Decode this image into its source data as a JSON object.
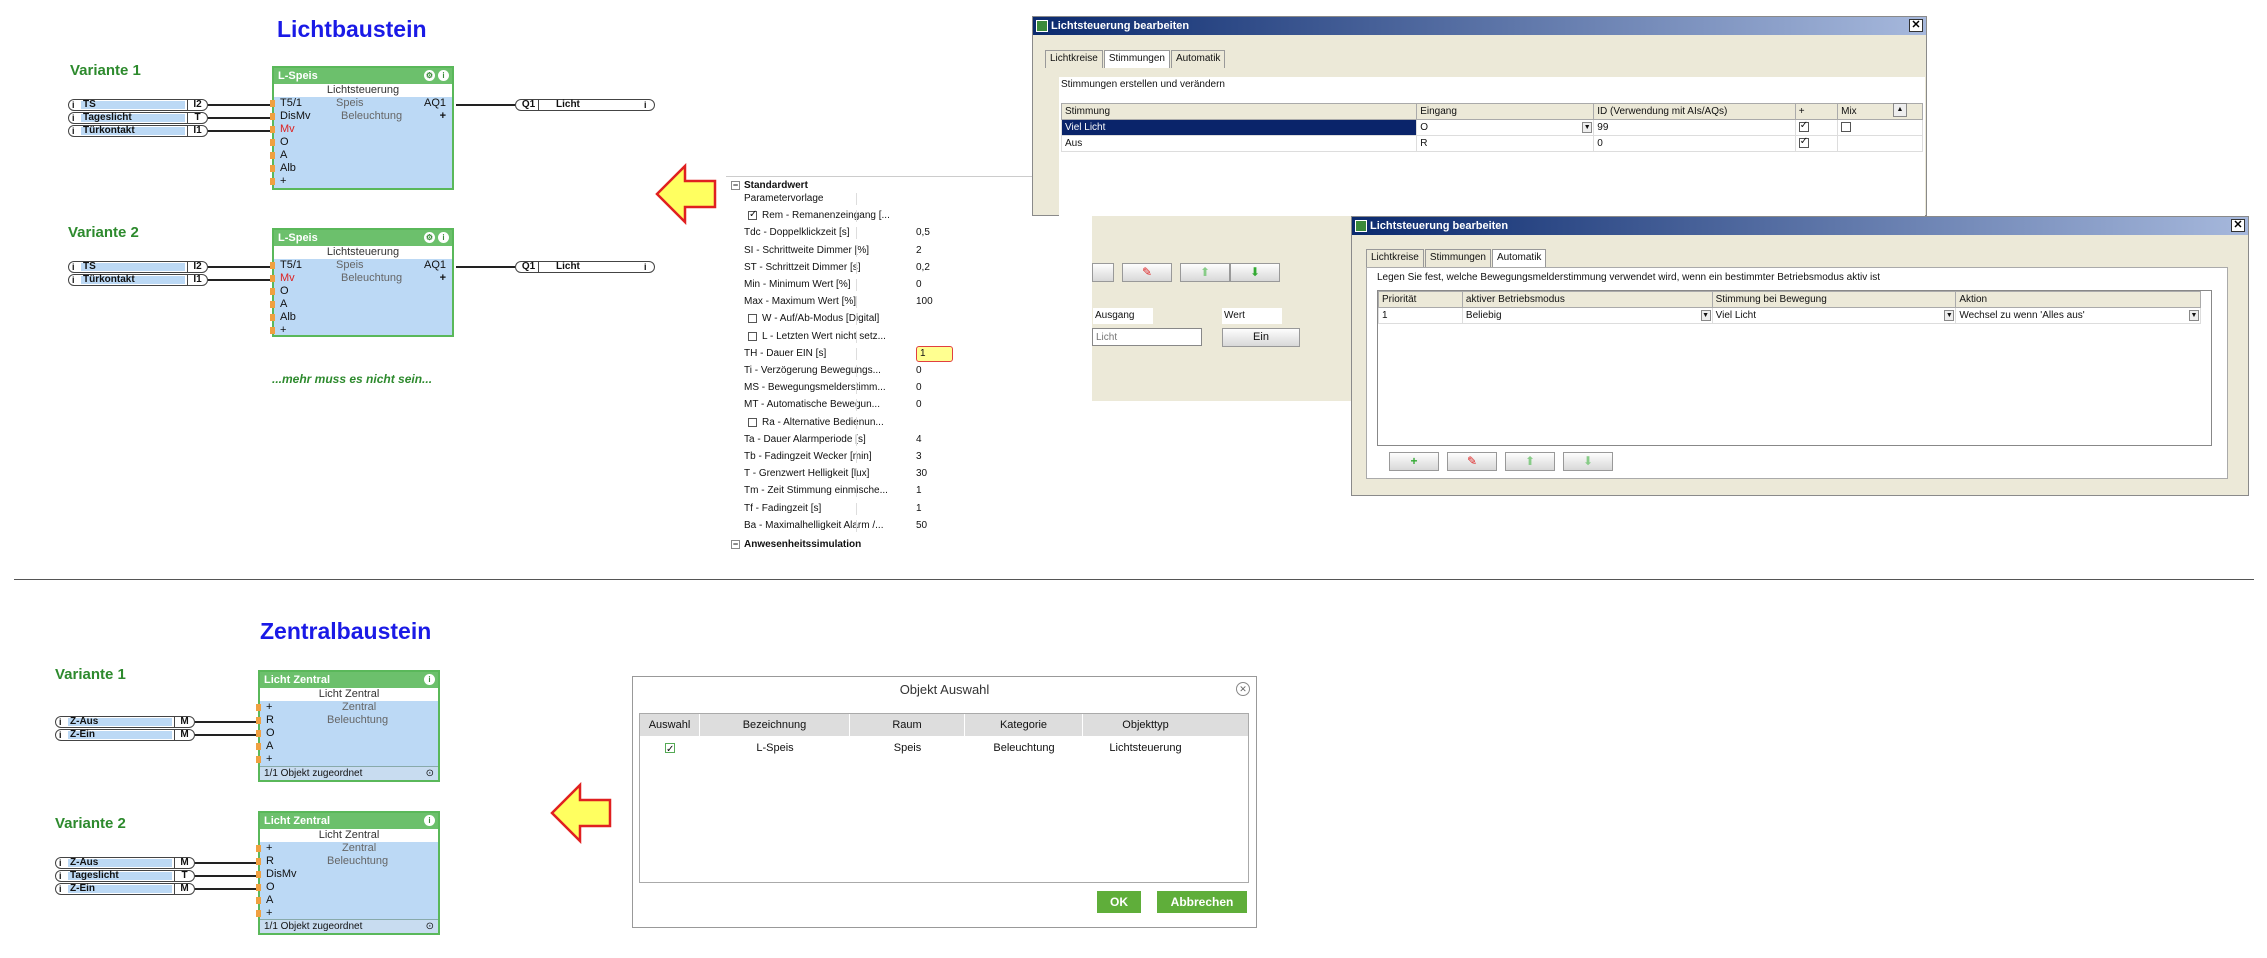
{
  "lichtbaustein": {
    "title": "Lichtbaustein",
    "variant1": "Variante 1",
    "variant2": "Variante 2",
    "note": "...mehr muss es nicht sein...",
    "block": {
      "title": "L-Speis",
      "sub": "Lichtsteuerung",
      "room": "Speis",
      "category": "Beleuchtung",
      "output": "AQ1"
    },
    "v1_pins": [
      "T5/1",
      "DisMv",
      "Mv",
      "O",
      "A",
      "Alb",
      "+"
    ],
    "v2_pins": [
      "T5/1",
      "Mv",
      "O",
      "A",
      "Alb",
      "+"
    ],
    "v1_inputs": [
      {
        "label": "TS",
        "tag": "I2"
      },
      {
        "label": "Tageslicht",
        "tag": "T"
      },
      {
        "label": "Türkontakt",
        "tag": "I1"
      }
    ],
    "v2_inputs": [
      {
        "label": "TS",
        "tag": "I2"
      },
      {
        "label": "Türkontakt",
        "tag": "I1"
      }
    ],
    "output": {
      "tag": "Q1",
      "label": "Licht"
    }
  },
  "zentralbaustein": {
    "title": "Zentralbaustein",
    "variant1": "Variante 1",
    "variant2": "Variante 2",
    "block": {
      "title": "Licht Zentral",
      "sub": "Licht Zentral",
      "room": "Zentral",
      "category": "Beleuchtung",
      "footer": "1/1 Objekt zugeordnet"
    },
    "v1_pins": [
      "+",
      "R",
      "O",
      "A",
      "+"
    ],
    "v2_pins": [
      "+",
      "R",
      "DisMv",
      "O",
      "A",
      "+"
    ],
    "v1_inputs": [
      {
        "label": "Z-Aus",
        "tag": "M"
      },
      {
        "label": "Z-Ein",
        "tag": "M"
      }
    ],
    "v2_inputs": [
      {
        "label": "Z-Aus",
        "tag": "M"
      },
      {
        "label": "Tageslicht",
        "tag": "T"
      },
      {
        "label": "Z-Ein",
        "tag": "M"
      }
    ]
  },
  "win_stimmungen": {
    "title": "Lichtsteuerung bearbeiten",
    "tabs": [
      "Lichtkreise",
      "Stimmungen",
      "Automatik"
    ],
    "caption": "Stimmungen erstellen und verändern",
    "headers": [
      "Stimmung",
      "Eingang",
      "ID (Verwendung mit AIs/AQs)",
      "+",
      "Mix"
    ],
    "rows": [
      {
        "stimmung": "Viel Licht",
        "eingang": "O",
        "id": "99"
      },
      {
        "stimmung": "Aus",
        "eingang": "R",
        "id": "0"
      }
    ],
    "ausgang_label": "Ausgang",
    "wert_label": "Wert",
    "ausgang_placeholder": "Licht",
    "ein_button": "Ein"
  },
  "win_automatik": {
    "title": "Lichtsteuerung bearbeiten",
    "tabs": [
      "Lichtkreise",
      "Stimmungen",
      "Automatik"
    ],
    "caption": "Legen Sie fest, welche Bewegungsmelderstimmung verwendet wird, wenn ein bestimmter Betriebsmodus aktiv ist",
    "headers": [
      "Priorität",
      "aktiver Betriebsmodus",
      "Stimmung bei Bewegung",
      "Aktion"
    ],
    "rows": [
      {
        "prio": "1",
        "modus": "Beliebig",
        "stimmung": "Viel Licht",
        "aktion": "Wechsel zu wenn 'Alles aus'"
      }
    ]
  },
  "properties": {
    "section": "Standardwert",
    "section2": "Anwesenheitssimulation",
    "rows": [
      {
        "k": "Parametervorlage",
        "v": ""
      },
      {
        "k": "Rem - Remanenzeingang [...",
        "v": "",
        "check": true
      },
      {
        "k": "Tdc - Doppelklickzeit [s]",
        "v": "0,5"
      },
      {
        "k": "SI - Schrittweite Dimmer [%]",
        "v": "2"
      },
      {
        "k": "ST - Schrittzeit Dimmer [s]",
        "v": "0,2"
      },
      {
        "k": "Min - Minimum Wert [%]",
        "v": "0"
      },
      {
        "k": "Max - Maximum Wert [%]",
        "v": "100"
      },
      {
        "k": "W - Auf/Ab-Modus [Digital]",
        "v": "",
        "check": false
      },
      {
        "k": "L - Letzten Wert nicht setz...",
        "v": "",
        "check": false
      },
      {
        "k": "TH - Dauer EIN [s]",
        "v": "1",
        "highlight": true
      },
      {
        "k": "Ti - Verzögerung Bewegungs...",
        "v": "0"
      },
      {
        "k": "MS - Bewegungsmelderstimm...",
        "v": "0"
      },
      {
        "k": "MT - Automatische Bewegun...",
        "v": "0"
      },
      {
        "k": "Ra - Alternative Bedienun...",
        "v": "",
        "check": false
      },
      {
        "k": "Ta - Dauer Alarmperiode [s]",
        "v": "4"
      },
      {
        "k": "Tb - Fadingzeit Wecker [min]",
        "v": "3"
      },
      {
        "k": "T - Grenzwert Helligkeit [lux]",
        "v": "30"
      },
      {
        "k": "Tm - Zeit Stimmung einmische...",
        "v": "1"
      },
      {
        "k": "Tf - Fadingzeit [s]",
        "v": "1"
      },
      {
        "k": "Ba - Maximalhelligkeit Alarm /...",
        "v": "50"
      }
    ]
  },
  "dialog": {
    "title": "Objekt Auswahl",
    "headers": [
      "Auswahl",
      "Bezeichnung",
      "Raum",
      "Kategorie",
      "Objekttyp"
    ],
    "row": {
      "bezeichnung": "L-Speis",
      "raum": "Speis",
      "kategorie": "Beleuchtung",
      "objekttyp": "Lichtsteuerung"
    },
    "ok": "OK",
    "cancel": "Abbrechen"
  }
}
